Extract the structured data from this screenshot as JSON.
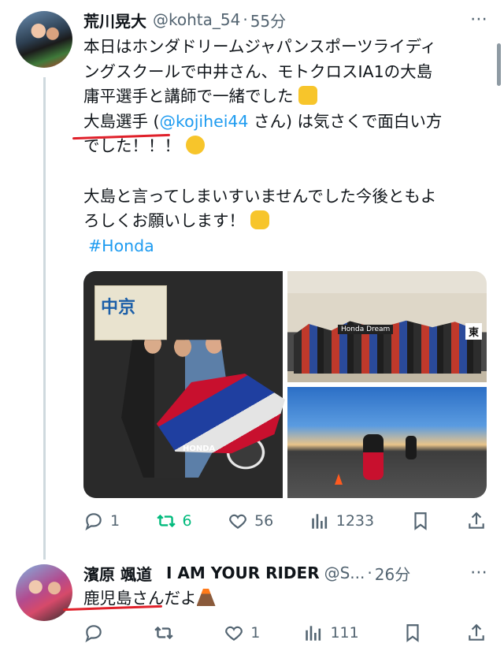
{
  "tweet": {
    "author_name": "荒川晃大",
    "handle": "@kohta_54",
    "separator": "·",
    "time": "55分",
    "more_label": "⋯",
    "text_lines": [
      "本日はホンダドリームジャパンスポーツライディ",
      "ングスクールで中井さん、モトクロスIA1の大島",
      "庸平選手と講師で一緒でした"
    ],
    "line4_prefix": "大島選手 (",
    "mention": "@kojihei44",
    "line4_suffix": " さん) は気さくで面白い方",
    "line5": "でした！！！",
    "line6": "大島と言ってしまいすいませんでした今後ともよ",
    "line7": "ろしくお願いします！",
    "hashtag": "#Honda",
    "emojis": [
      "raising-hands-emoji",
      "laughing-emoji",
      "raised-fist-emoji"
    ],
    "media": {
      "main_sign": "中京",
      "bike_brand": "HONDA",
      "group_banner": "Honda Dream",
      "group_kanji": "東"
    },
    "actions": {
      "replies": "1",
      "retweets": "6",
      "likes": "56",
      "views": "1233"
    }
  },
  "reply": {
    "author_name": "濱原 颯道",
    "author_tagline": "I AM YOUR RIDER",
    "handle": "@S...",
    "separator": "·",
    "time": "26分",
    "more_label": "⋯",
    "text": "鹿児島さんだよ",
    "emoji": "volcano-emoji",
    "actions": {
      "replies": "",
      "retweets": "",
      "likes": "1",
      "views": "111"
    }
  },
  "colors": {
    "link": "#1d9bf0",
    "retweet_active": "#00ba7c",
    "secondary_text": "#536471",
    "annotation_underline": "#e0202a"
  }
}
